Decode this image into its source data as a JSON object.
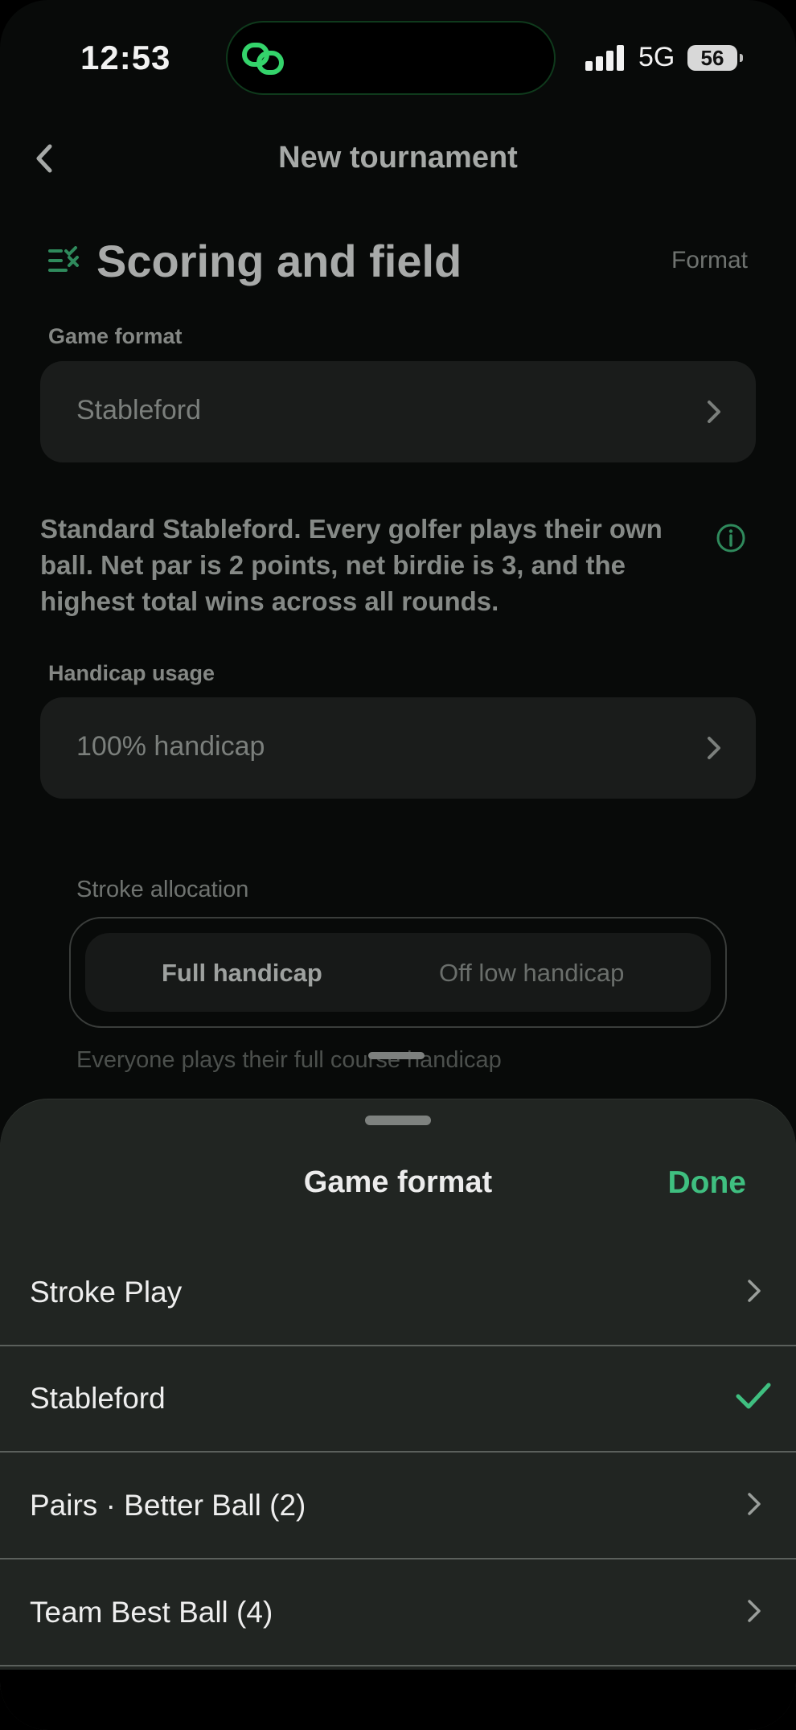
{
  "status_bar": {
    "time": "12:53",
    "network": "5G",
    "battery": "56"
  },
  "nav": {
    "title": "New tournament",
    "back_icon": "chevron-left-icon"
  },
  "section": {
    "title": "Scoring and field",
    "icon": "checklist-icon",
    "format_link": "Format"
  },
  "game_format_field": {
    "label": "Game format",
    "value": "Stableford"
  },
  "description": "Standard Stableford. Every golfer plays their own ball. Net par is 2 points, net birdie is 3, and the highest total wins across all rounds.",
  "handicap_field": {
    "label": "Handicap usage",
    "value": "100% handicap"
  },
  "stroke_allocation": {
    "label": "Stroke allocation",
    "options": [
      "Full handicap",
      "Off low handicap"
    ],
    "selected": "Full handicap",
    "help": "Everyone plays their full course handicap"
  },
  "sheet": {
    "title": "Game format",
    "done_label": "Done",
    "accent": "#3fbf80",
    "options": [
      {
        "label": "Stroke Play",
        "selected": false
      },
      {
        "label": "Stableford",
        "selected": true
      },
      {
        "label": "Pairs · Better Ball (2)",
        "selected": false
      },
      {
        "label": "Team Best Ball (4)",
        "selected": false
      }
    ]
  }
}
